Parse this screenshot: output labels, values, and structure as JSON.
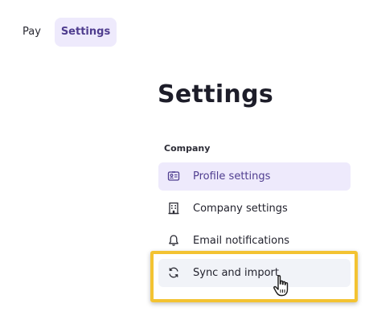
{
  "nav": {
    "tabs": [
      {
        "label": "Pay",
        "active": false
      },
      {
        "label": "Settings",
        "active": true
      }
    ]
  },
  "page": {
    "title": "Settings"
  },
  "settings_menu": {
    "section_label": "Company",
    "items": [
      {
        "label": "Profile settings",
        "icon": "id-card-icon",
        "selected": true
      },
      {
        "label": "Company settings",
        "icon": "building-icon",
        "selected": false
      },
      {
        "label": "Email notifications",
        "icon": "bell-icon",
        "selected": false
      },
      {
        "label": "Sync and import",
        "icon": "sync-icon",
        "selected": false,
        "hovered": true,
        "highlighted": true
      }
    ]
  },
  "colors": {
    "accent": "#4f3d8f",
    "selected_bg": "#eeeafc",
    "hover_bg": "#f1f3f8",
    "highlight_border": "#f3c332"
  },
  "cursor": {
    "icon": "hand-pointer-cursor-icon"
  }
}
